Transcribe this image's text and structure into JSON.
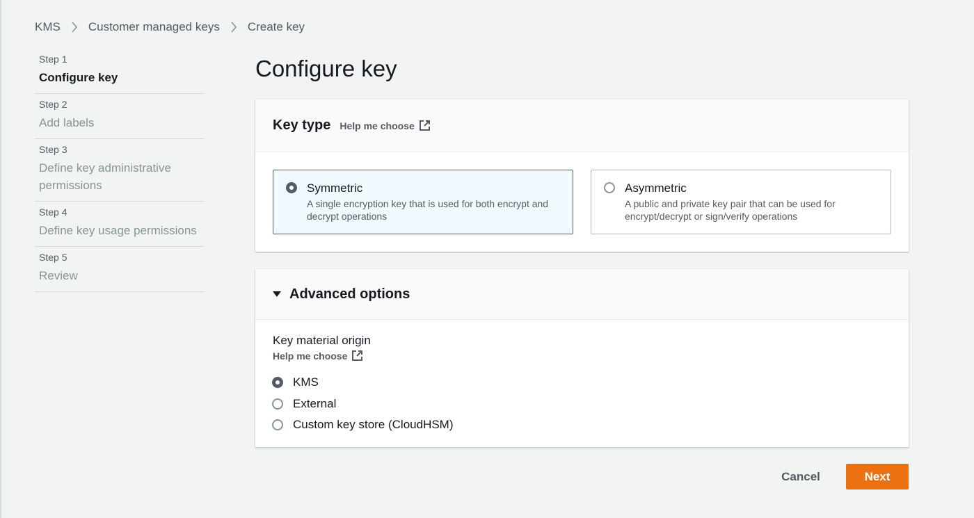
{
  "breadcrumb": [
    "KMS",
    "Customer managed keys",
    "Create key"
  ],
  "steps": [
    {
      "num": "Step 1",
      "title": "Configure key",
      "active": true
    },
    {
      "num": "Step 2",
      "title": "Add labels"
    },
    {
      "num": "Step 3",
      "title": "Define key administrative permissions"
    },
    {
      "num": "Step 4",
      "title": "Define key usage permissions"
    },
    {
      "num": "Step 5",
      "title": "Review"
    }
  ],
  "page_title": "Configure key",
  "key_type": {
    "heading": "Key type",
    "help_link": "Help me choose",
    "options": [
      {
        "title": "Symmetric",
        "description": "A single encryption key that is used for both encrypt and decrypt operations",
        "selected": true
      },
      {
        "title": "Asymmetric",
        "description": "A public and private key pair that can be used for encrypt/decrypt or sign/verify operations",
        "selected": false
      }
    ]
  },
  "advanced": {
    "heading": "Advanced options",
    "field_label": "Key material origin",
    "help_link": "Help me choose",
    "options": [
      {
        "label": "KMS",
        "selected": true
      },
      {
        "label": "External",
        "selected": false
      },
      {
        "label": "Custom key store (CloudHSM)",
        "selected": false
      }
    ]
  },
  "footer": {
    "cancel": "Cancel",
    "next": "Next"
  },
  "colors": {
    "primary": "#ec7211",
    "selected_tile_bg": "#f1faff",
    "text": "#16191f",
    "muted": "#545b64"
  },
  "icons": {
    "breadcrumb_separator": "chevron-right-icon",
    "help_link": "external-link-icon",
    "expand": "caret-down-icon"
  }
}
